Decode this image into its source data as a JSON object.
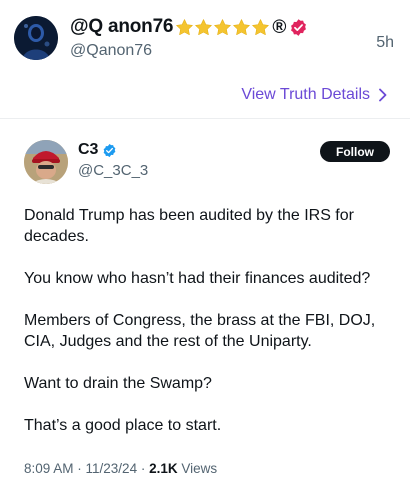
{
  "post": {
    "display_name": "@Q anon76",
    "stars_count": 5,
    "registered_mark": "®",
    "handle": "@Qanon76",
    "time_ago": "5h",
    "view_details_label": "View Truth Details"
  },
  "embedded_post": {
    "display_name": "C3",
    "handle": "@C_3C_3",
    "follow_label": "Follow",
    "paragraphs": [
      "Donald Trump has been audited by the IRS for decades.",
      "You know who hasn’t had their finances audited?",
      "Members of Congress, the brass at the FBI, DOJ, CIA, Judges and the rest of the Uniparty.",
      "Want to drain the Swamp?",
      "That’s a good place to start."
    ],
    "timestamp": "8:09 AM · 11/23/24 · ",
    "views_count": "2.1K",
    "views_label": " Views"
  },
  "colors": {
    "accent_purple": "#6b49d6",
    "verified_pink": "#e0245e",
    "verified_blue": "#1d9bf0",
    "star_gold": "#f4c430",
    "text_primary": "#0f1419",
    "text_secondary": "#536471"
  },
  "icons": [
    "star-icon",
    "registered-mark",
    "verified-badge-icon",
    "chevron-right-icon"
  ]
}
